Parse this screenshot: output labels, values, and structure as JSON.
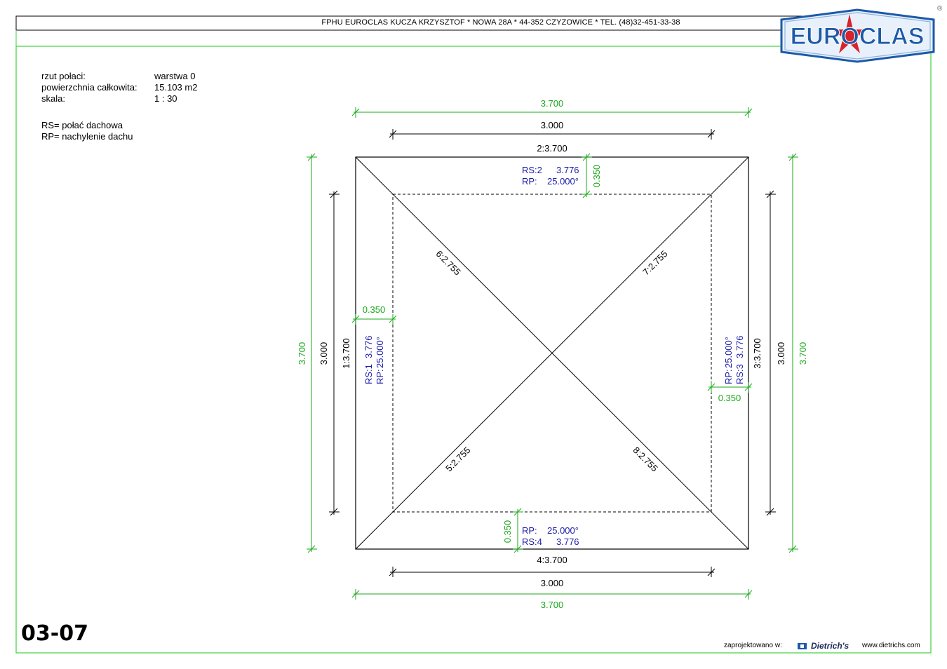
{
  "header": {
    "company_line": "FPHU EUROCLAS KUCZA KRZYSZTOF * NOWA 28A * 44-352 CZYZOWICE * TEL. (48)32-451-33-38",
    "logo_text": "EUROCLAS",
    "registered_mark": "®"
  },
  "info": {
    "rows": [
      {
        "label": "rzut połaci:",
        "value": "warstwa 0"
      },
      {
        "label": "powierzchnia całkowita:",
        "value": "15.103 m2"
      },
      {
        "label": "skala:",
        "value": "1 : 30"
      }
    ],
    "legend": [
      "RS= połać dachowa",
      "RP= nachylenie dachu"
    ]
  },
  "plan": {
    "overall_top": "3.700",
    "inner_top": "3.000",
    "edge_top": "2:3.700",
    "overall_bottom": "3.700",
    "inner_bottom": "3.000",
    "edge_bottom": "4:3.700",
    "overall_left": "3.700",
    "inner_left": "3.000",
    "edge_left": "1:3.700",
    "overall_right": "3.700",
    "inner_right": "3.000",
    "edge_right": "3:3.700",
    "overhang_top": "0.350",
    "overhang_left": "0.350",
    "overhang_right": "0.350",
    "overhang_bottom": "0.350",
    "hips": {
      "nw": "6:2.755",
      "ne": "7:2.755",
      "sw": "5:2.755",
      "se": "8:2.755"
    },
    "faces": {
      "top": {
        "rs": "RS:2",
        "rs_val": "3.776",
        "rp": "RP:",
        "rp_val": "25.000°"
      },
      "left": {
        "rs": "RS:1",
        "rs_val": "3.776",
        "rp": "RP:",
        "rp_val": "25.000°"
      },
      "right": {
        "rs": "RS:3",
        "rs_val": "3.776",
        "rp": "RP:",
        "rp_val": "25.000°"
      },
      "bottom": {
        "rs": "RS:4",
        "rs_val": "3.776",
        "rp": "RP:",
        "rp_val": "25.000°"
      }
    }
  },
  "footer": {
    "sheet_number": "03-07",
    "designed_in": "zaprojektowano w:",
    "software": "Dietrich's",
    "website": "www.dietrichs.com"
  },
  "colors": {
    "green": "#1aa81a",
    "blue": "#1a1aa8",
    "frame": "#3cd23c",
    "logo_blue": "#1c5aa8",
    "logo_red": "#d8232a"
  }
}
